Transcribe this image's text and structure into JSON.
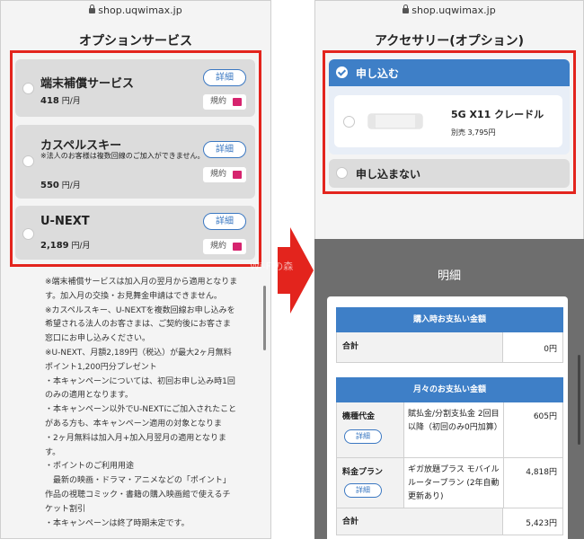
{
  "left": {
    "url": "shop.uqwimax.jp",
    "section_title": "オプションサービス",
    "options": [
      {
        "name": "端末補償サービス",
        "note": "",
        "price": "418",
        "unit": "円/月",
        "detail": "詳細",
        "terms": "規約"
      },
      {
        "name": "カスペルスキー",
        "note": "※法人のお客様は複数回線のご加入ができません。",
        "price": "550",
        "unit": "円/月",
        "detail": "詳細",
        "terms": "規約"
      },
      {
        "name": "U-NEXT",
        "note": "",
        "price": "2,189",
        "unit": "円/月",
        "detail": "詳細",
        "terms": "規約"
      }
    ],
    "notes": [
      "※端末補償サービスは加入月の翌月から適用となりま",
      "す。加入月の交換・お見舞金申請はできません。",
      "※カスペルスキー、U-NEXTを複数回線お申し込みを",
      "希望される法人のお客さまは、ご契約後にお客さま",
      "窓口にお申し込みください。",
      "※U-NEXT、月額2,189円（税込）が最大2ヶ月無料",
      "ポイント1,200円分プレゼント",
      "・本キャンペーンについては、初回お申し込み時1回",
      "のみの適用となります。",
      "・本キャンペーン以外でU-NEXTにご加入されたこと",
      "がある方も、本キャンペーン適用の対象となりま",
      "・2ヶ月無料は加入月+加入月翌月の適用となりま",
      "す。",
      "・ポイントのご利用用途",
      "　最新の映画・ドラマ・アニメなどの「ポイント」",
      "作品の視聴コミック・書籍の購入映画館で使えるチ",
      "ケット割引",
      "・本キャンペーンは終了時期未定です。"
    ]
  },
  "right": {
    "url": "shop.uqwimax.jp",
    "section_title": "アクセサリー(オプション)",
    "apply_label": "申し込む",
    "product_name": "5G X11 クレードル",
    "product_price": "別売 3,795円",
    "no_apply_label": "申し込まない",
    "meisai_title": "明細",
    "purchase_header": "購入時お支払い金額",
    "purchase_total_label": "合計",
    "purchase_total_value": "0円",
    "monthly_header": "月々のお支払い金額",
    "rows": [
      {
        "label": "機種代金",
        "button": "詳細",
        "desc": "賦払金/分割支払金 2回目以降（初回のみ0円加算）",
        "value": "605円"
      },
      {
        "label": "料金プラン",
        "button": "詳細",
        "desc": "ギガ放題プラス モバイルルータープラン (2年自動更新あり)",
        "value": "4,818円"
      }
    ],
    "monthly_total_label": "合計",
    "monthly_total_value": "5,423円"
  },
  "watermark": "Wi-Fiの森",
  "colors": {
    "highlight": "#e3241d",
    "accent": "#3e7fc7",
    "arrow": "#e3241d"
  }
}
